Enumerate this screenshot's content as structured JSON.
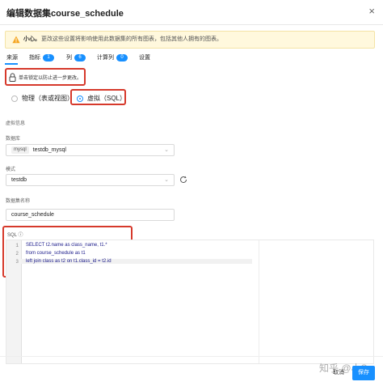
{
  "dialog": {
    "title": "编辑数据集course_schedule"
  },
  "warning": {
    "head": "小心。",
    "text": "更改这些设置将影响使用此数据集的所有图表，包括其他人拥有的图表。"
  },
  "tabs": [
    {
      "label": "来源"
    },
    {
      "label": "指标",
      "count": "1"
    },
    {
      "label": "列",
      "count": "6"
    },
    {
      "label": "计算列",
      "count": "0"
    },
    {
      "label": "设置"
    }
  ],
  "lock": {
    "text": "单击锁定以防止进一步更改。"
  },
  "source_type": {
    "options": [
      "物理（表或视图）",
      "虚拟（SQL）"
    ],
    "selected": "虚拟（SQL）"
  },
  "virtual_info": {
    "label": "虚拟信息"
  },
  "database": {
    "label": "数据库",
    "tag": "mysql",
    "value": "testdb_mysql"
  },
  "schema": {
    "label": "模式",
    "value": "testdb"
  },
  "dataset_name": {
    "label": "数据集名称",
    "value": "course_schedule"
  },
  "sql": {
    "label": "SQL",
    "lines": [
      "SELECT t2.name as class_name, t1.*",
      "from course_schedule as t1",
      "left join class as t2 on t1.class_id = t2.id"
    ],
    "line_numbers": [
      "1",
      "2",
      "3"
    ]
  },
  "footer": {
    "cancel": "取消",
    "save": "保存",
    "watermark": "知乎 @小S"
  },
  "colors": {
    "accent": "#1890ff",
    "highlight_box": "#d6392b",
    "warning_bg": "#fff8dd"
  }
}
